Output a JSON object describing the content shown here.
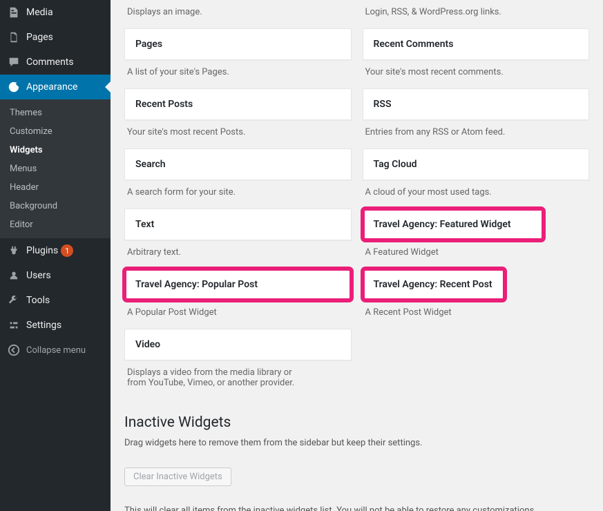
{
  "sidebar": {
    "items": [
      {
        "label": "Media"
      },
      {
        "label": "Pages"
      },
      {
        "label": "Comments"
      },
      {
        "label": "Appearance"
      },
      {
        "label": "Plugins",
        "badge": "1"
      },
      {
        "label": "Users"
      },
      {
        "label": "Tools"
      },
      {
        "label": "Settings"
      }
    ],
    "submenu": [
      "Themes",
      "Customize",
      "Widgets",
      "Menus",
      "Header",
      "Background",
      "Editor"
    ],
    "collapse": "Collapse menu"
  },
  "widgets": {
    "left": [
      {
        "desc": "Displays an image."
      },
      {
        "title": "Pages",
        "desc": "A list of your site's Pages."
      },
      {
        "title": "Recent Posts",
        "desc": "Your site's most recent Posts."
      },
      {
        "title": "Search",
        "desc": "A search form for your site."
      },
      {
        "title": "Text",
        "desc": "Arbitrary text."
      },
      {
        "title": "Travel Agency: Popular Post",
        "desc": "A Popular Post Widget",
        "hl": true
      },
      {
        "title": "Video",
        "desc": "Displays a video from the media library or from YouTube, Vimeo, or another provider."
      }
    ],
    "right": [
      {
        "desc": "Login, RSS, & WordPress.org links."
      },
      {
        "title": "Recent Comments",
        "desc": "Your site's most recent comments."
      },
      {
        "title": "RSS",
        "desc": "Entries from any RSS or Atom feed."
      },
      {
        "title": "Tag Cloud",
        "desc": "A cloud of your most used tags."
      },
      {
        "title": "Travel Agency: Featured Widget",
        "desc": "A Featured Widget",
        "hl": true
      },
      {
        "title": "Travel Agency: Recent Post",
        "desc": "A Recent Post Widget",
        "hl": true
      }
    ]
  },
  "inactive": {
    "heading": "Inactive Widgets",
    "sub": "Drag widgets here to remove them from the sidebar but keep their settings.",
    "button": "Clear Inactive Widgets",
    "note": "This will clear all items from the inactive widgets list. You will not be able to restore any customizations."
  }
}
